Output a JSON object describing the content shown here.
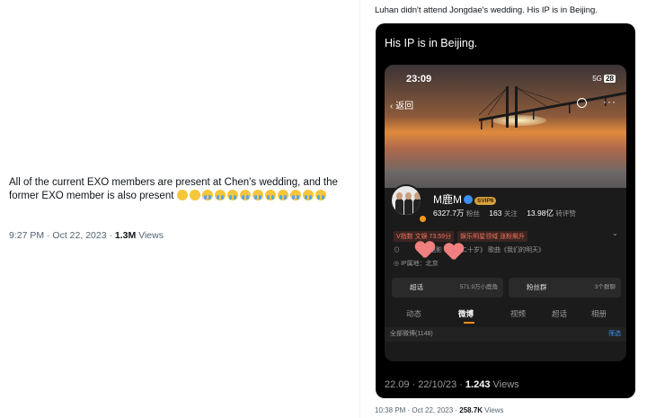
{
  "left_tweet": {
    "text": "All of the current EXO members are present at Chen's wedding, and the former EXO member is also present ",
    "emojis": [
      "🥺",
      "🥺",
      "😭",
      "😭",
      "😭",
      "😭",
      "😭",
      "😭",
      "😭",
      "😭",
      "😭",
      "😭"
    ],
    "time": "9:27 PM · Oct 22, 2023 · ",
    "views_count": "1.3M",
    "views_label": " Views"
  },
  "right_tweet": {
    "caption": "Luhan didn't attend Jongdae's wedding. His IP is in Beijing.",
    "video_title": "His IP is in Beijing.",
    "video_stats_prefix": "22.09 · 22/10/23 · ",
    "video_views": "1.243",
    "video_views_label": " Views",
    "time": "10:38 PM · Oct 22, 2023 · ",
    "views_count": "258.7K",
    "views_label": " Views"
  },
  "phone": {
    "time": "23:09",
    "signal": "5G",
    "battery": "28",
    "back_label": "返回",
    "profile_name": "M鹿M",
    "vip_label": "SVIP6",
    "followers_count": "6327.7万",
    "followers_label": "粉丝",
    "following_count": "163",
    "following_label": "关注",
    "reposts_count": "13.98亿",
    "reposts_label": "转评赞",
    "tag1": "V指数 文娱 73.59分",
    "tag2": "娱乐明星领域 涨粉飙升",
    "info_line": "电影《重返二十岁》 歌曲《我们的明天》",
    "ip_location": "IP属地：北京",
    "card1_label": "超话",
    "card1_sub": "571.9万小鹿角",
    "card2_label": "粉丝群",
    "card2_sub": "3个群聊",
    "tabs": [
      "动态",
      "微博",
      "视频",
      "超话",
      "相册"
    ],
    "all_posts_label": "全部微博(1148)",
    "filter_label": "筛选"
  },
  "colors": {
    "accent_orange": "#f58a1f",
    "link_blue": "#3b8ff2",
    "heart_pink": "#f08080"
  }
}
